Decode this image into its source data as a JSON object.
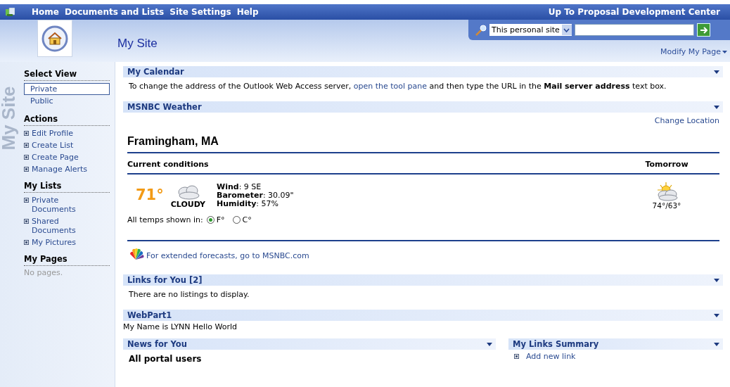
{
  "top_nav": {
    "items": [
      "Home",
      "Documents and Lists",
      "Site Settings",
      "Help"
    ],
    "up_link": "Up To Proposal Development Center"
  },
  "header": {
    "title": "My Site",
    "search_scope": "This personal site",
    "modify_link": "Modify My Page"
  },
  "sidebar": {
    "watermark": "My Site",
    "sections": [
      {
        "title": "Select View",
        "kind": "views",
        "items": [
          {
            "label": "Private",
            "selected": true
          },
          {
            "label": "Public",
            "selected": false
          }
        ]
      },
      {
        "title": "Actions",
        "kind": "links",
        "items": [
          {
            "label": "Edit Profile"
          },
          {
            "label": "Create List"
          },
          {
            "label": "Create Page"
          },
          {
            "label": "Manage Alerts"
          }
        ]
      },
      {
        "title": "My Lists",
        "kind": "links",
        "items": [
          {
            "label": "Private Documents"
          },
          {
            "label": "Shared Documents"
          },
          {
            "label": "My Pictures"
          }
        ]
      },
      {
        "title": "My Pages",
        "kind": "note",
        "items": [
          {
            "label": "No pages."
          }
        ]
      }
    ]
  },
  "calendar": {
    "title": "My Calendar",
    "text_before": "To change the address of the Outlook Web Access server,",
    "link": "open the tool pane",
    "text_after": "and then type the URL in the **Mail server address** text box."
  },
  "weather": {
    "title": "MSNBC Weather",
    "change_location": "Change Location",
    "city": "Framingham, MA",
    "current_label": "Current conditions",
    "tomorrow_label": "Tomorrow",
    "temp": "71°",
    "condition": "CLOUDY",
    "details": [
      "**Wind**: 9 SE",
      "**Barometer**: 30.09\"",
      "**Humidity**: 57%"
    ],
    "units_label": "All temps shown in:",
    "units": [
      {
        "label": "F°",
        "selected": true
      },
      {
        "label": "C°",
        "selected": false
      }
    ],
    "tomorrow_temps": "74°/63°",
    "forecast_link": "For extended forecasts, go to MSNBC.com"
  },
  "links_for_you": {
    "title": "Links for You [2]",
    "text": "There are no listings to display."
  },
  "webpart1": {
    "title": "WebPart1",
    "text": "My Name is LYNN Hello World"
  },
  "news": {
    "title": "News for You",
    "heading": "All portal users"
  },
  "my_links": {
    "title": "My Links Summary",
    "items": [
      "Add new link"
    ]
  }
}
